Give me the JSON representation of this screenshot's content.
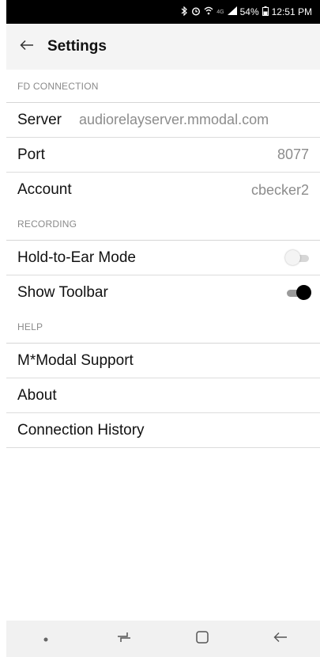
{
  "status_bar": {
    "battery": "54%",
    "time": "12:51 PM",
    "network": "4G"
  },
  "app_bar": {
    "title": "Settings"
  },
  "sections": {
    "fd_connection": {
      "header": "FD CONNECTION",
      "server": {
        "label": "Server",
        "value": "audiorelayserver.mmodal.com"
      },
      "port": {
        "label": "Port",
        "value": "8077"
      },
      "account": {
        "label": "Account",
        "value": "cbecker2"
      }
    },
    "recording": {
      "header": "RECORDING",
      "hold_to_ear": {
        "label": "Hold-to-Ear Mode",
        "enabled": false
      },
      "show_toolbar": {
        "label": "Show Toolbar",
        "enabled": true
      }
    },
    "help": {
      "header": "HELP",
      "items": [
        "M*Modal Support",
        "About",
        "Connection History"
      ]
    }
  },
  "icons": {
    "back": "arrow-left-icon",
    "nav": [
      "dot-icon",
      "recent-apps-icon",
      "home-icon",
      "back-icon"
    ]
  }
}
